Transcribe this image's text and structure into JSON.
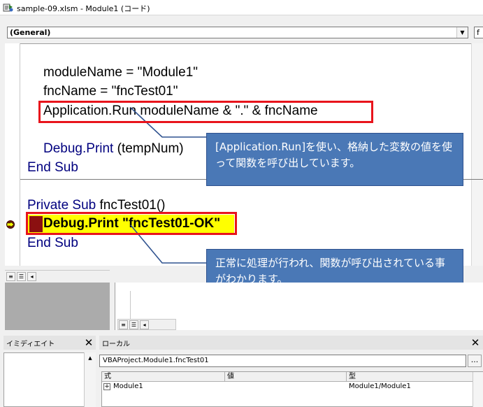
{
  "window": {
    "title": "sample-09.xlsm - Module1 (コード)"
  },
  "combos": {
    "procedure": "(General)",
    "procedure_arrow": "▼",
    "right": "f"
  },
  "code": {
    "lines": [
      {
        "text": "moduleName = \"Module1\""
      },
      {
        "text": "fncName = \"fncTest01\""
      },
      {
        "text": "Application.Run moduleName & \".\" & fncName"
      },
      {
        "kw": "Debug.Print",
        "rest": " (tempNum)"
      },
      {
        "kw": "End Sub"
      },
      {
        "kw": "Private Sub",
        "rest": " fncTest01()"
      },
      {
        "text": "Debug.Print \"fncTest01-OK\""
      },
      {
        "kw": "End Sub"
      }
    ],
    "current_line": 6
  },
  "callouts": [
    {
      "text": "[Application.Run]を使い、格納した変数の値を使って関数を呼び出しています。"
    },
    {
      "text": "正常に処理が行われ、関数が呼び出されている事がわかります。"
    }
  ],
  "immediate": {
    "title": "イミディエイト",
    "close": "✕"
  },
  "locals": {
    "title": "ローカル",
    "close": "✕",
    "context": "VBAProject.Module1.fncTest01",
    "context_btn": "...",
    "columns": [
      "式",
      "値",
      "型"
    ],
    "rows": [
      {
        "expand": "+",
        "expression": "Module1",
        "value": "",
        "type": "Module1/Module1"
      }
    ]
  },
  "colors": {
    "keyword": "#00007f",
    "highlight": "#ffff00",
    "callout": "#4a78b6",
    "annotation_border": "#e8141c"
  }
}
